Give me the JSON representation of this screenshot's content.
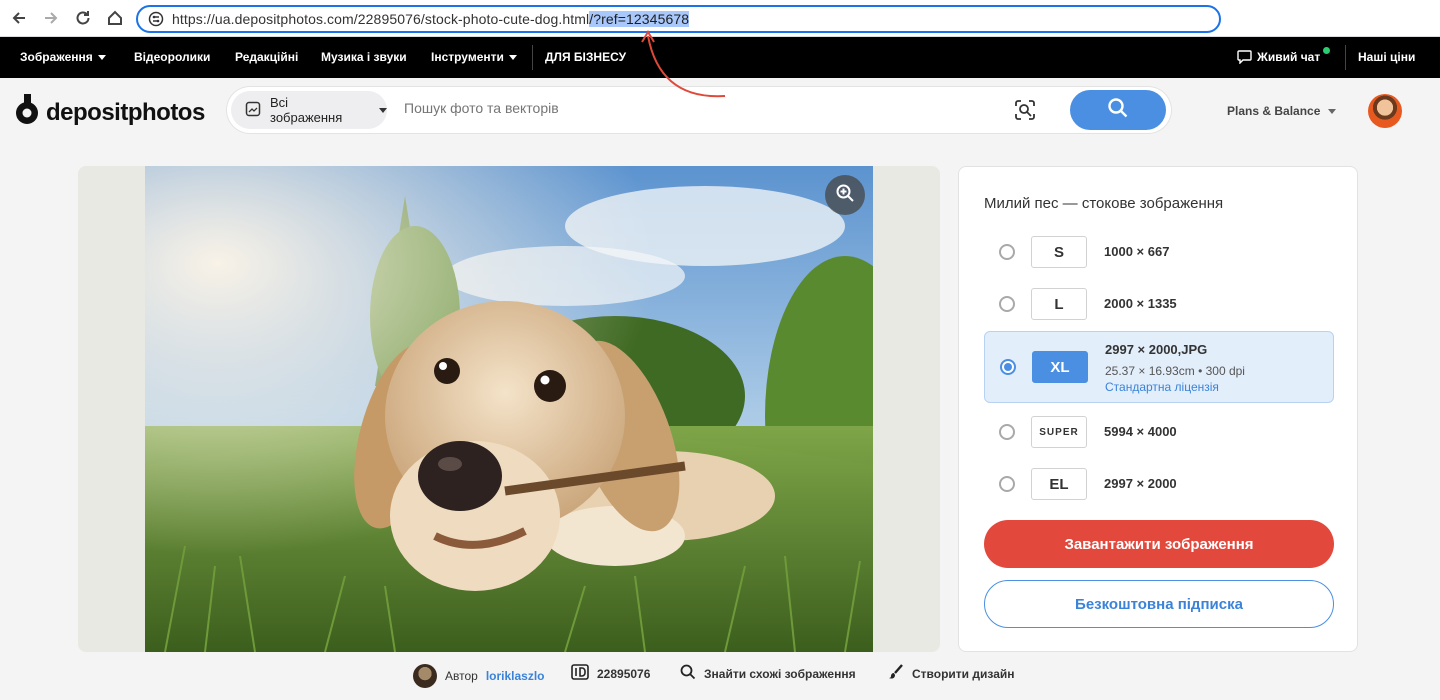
{
  "browser": {
    "url_main": "https://ua.depositphotos.com/22895076/stock-photo-cute-dog.html",
    "url_selected": "/?ref=12345678",
    "icons": [
      "back-icon",
      "forward-icon",
      "reload-icon",
      "home-icon",
      "site-info-icon"
    ]
  },
  "topnav": {
    "items": [
      "Зображення",
      "Відеоролики",
      "Редакційні",
      "Музика і звуки",
      "Інструменти",
      "ДЛЯ БІЗНЕСУ"
    ],
    "chat": "Живий чат",
    "prices": "Наші ціни"
  },
  "header": {
    "logo": "depositphotos",
    "type_select": "Всі зображення",
    "search_placeholder": "Пошук фото та векторів",
    "plans": "Plans & Balance"
  },
  "panel": {
    "title": "Милий пес — стокове зображення",
    "sizes": [
      {
        "code": "S",
        "dims": "1000 × 667"
      },
      {
        "code": "L",
        "dims": "2000 × 1335"
      },
      {
        "code": "XL",
        "dims": "2997 × 2000,JPG",
        "sub": "25.37 × 16.93cm • 300 dpi",
        "license": "Стандартна ліцензія"
      },
      {
        "code": "SUPER",
        "dims": "5994 × 4000"
      },
      {
        "code": "EL",
        "dims": "2997 × 2000"
      }
    ],
    "selected_size": "XL",
    "download": "Завантажити зображення",
    "subscribe": "Безкоштовна підписка"
  },
  "bottom": {
    "author_label": "Автор",
    "author": "loriklaszlo",
    "id": "22895076",
    "similar": "Знайти схожі зображення",
    "design": "Створити дизайн"
  },
  "colors": {
    "accent": "#4a8fe2",
    "download": "#e2483c",
    "annotation": "#e0493a"
  }
}
